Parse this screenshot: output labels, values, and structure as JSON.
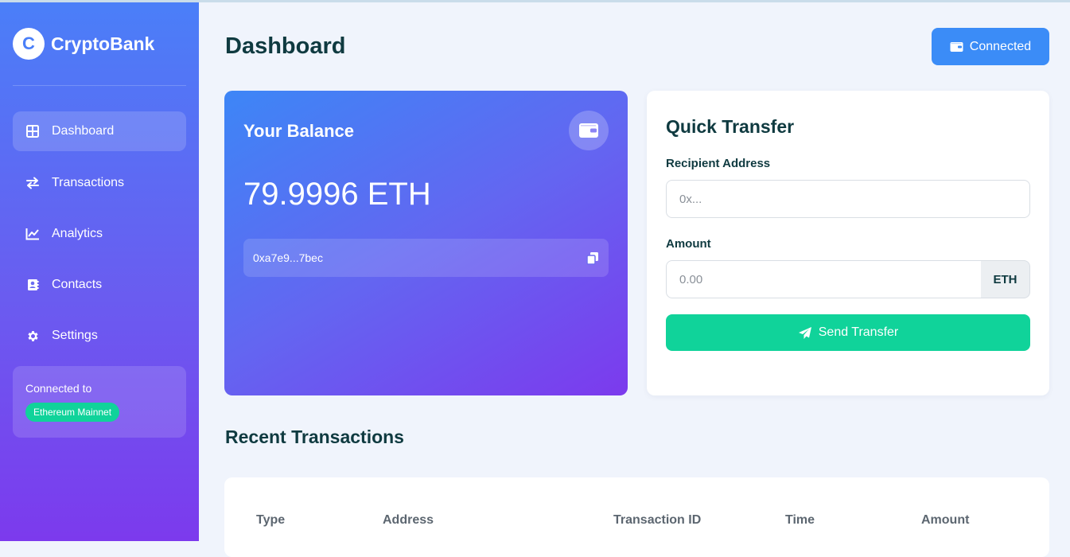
{
  "brand": {
    "logo_letter": "C",
    "name": "CryptoBank"
  },
  "sidebar": {
    "items": [
      {
        "label": "Dashboard",
        "icon": "grid-icon",
        "active": true
      },
      {
        "label": "Transactions",
        "icon": "swap-arrows-icon",
        "active": false
      },
      {
        "label": "Analytics",
        "icon": "line-chart-icon",
        "active": false
      },
      {
        "label": "Contacts",
        "icon": "address-book-icon",
        "active": false
      },
      {
        "label": "Settings",
        "icon": "gear-icon",
        "active": false
      }
    ],
    "network": {
      "label": "Connected to",
      "badge": "Ethereum Mainnet"
    }
  },
  "header": {
    "title": "Dashboard",
    "connect_button": "Connected",
    "connect_icon": "wallet-icon"
  },
  "balance": {
    "title": "Your Balance",
    "amount": "79.9996 ETH",
    "address": "0xa7e9...7bec",
    "wallet_icon": "wallet-icon",
    "copy_icon": "copy-icon"
  },
  "transfer": {
    "title": "Quick Transfer",
    "recipient_label": "Recipient Address",
    "recipient_placeholder": "0x...",
    "amount_label": "Amount",
    "amount_placeholder": "0.00",
    "currency": "ETH",
    "send_button": "Send Transfer",
    "send_icon": "paper-plane-icon"
  },
  "transactions": {
    "title": "Recent Transactions",
    "columns": [
      "Type",
      "Address",
      "Transaction ID",
      "Time",
      "Amount"
    ]
  },
  "colors": {
    "primary": "#3b8cf7",
    "accent_purple": "#7c3aed",
    "success": "#10d39a",
    "heading": "#0f3a40",
    "background": "#f0f4fc"
  }
}
